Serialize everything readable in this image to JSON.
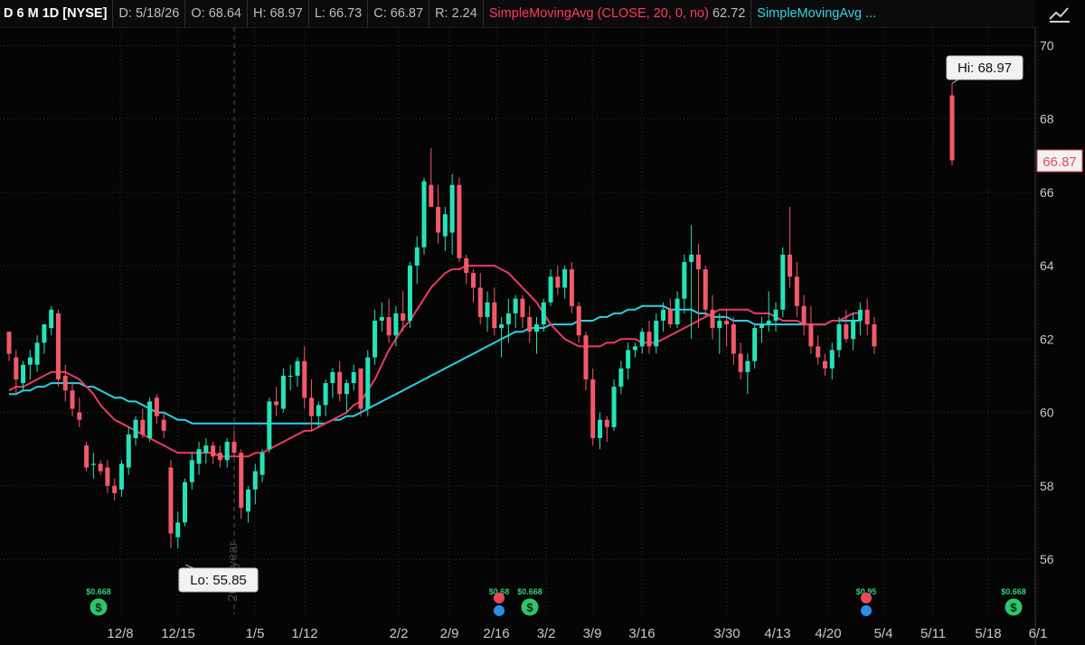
{
  "header": {
    "symbol": "D 6 M 1D [NYSE]",
    "date_label": "D:",
    "date": "5/18/26",
    "open_label": "O:",
    "open": "68.64",
    "high_label": "H:",
    "high": "68.97",
    "low_label": "L:",
    "low": "66.73",
    "close_label": "C:",
    "close": "66.87",
    "range_label": "R:",
    "range": "2.24",
    "study1": "SimpleMovingAvg (CLOSE, 20, 0, no)",
    "study1_value": "62.72",
    "study2": "SimpleMovingAvg ..."
  },
  "icons": {
    "style_button": "trend-line-icon",
    "dividend": "dollar-icon",
    "earnings": "earnings-icon"
  },
  "colors": {
    "up": "#25e3b8",
    "down": "#f2596b",
    "sma20": "#ea3a62",
    "sma50": "#27d3e6",
    "grid": "#2f2f2f",
    "background": "#050505"
  },
  "chart_data": {
    "type": "candlestick",
    "ylim": [
      54.5,
      70.5
    ],
    "y_ticks": [
      "56",
      "58",
      "60",
      "62",
      "64",
      "66",
      "68",
      "70"
    ],
    "x_ticks": [
      "12/8",
      "12/15",
      "1/5",
      "1/12",
      "2/2",
      "2/9",
      "2/16",
      "3/2",
      "3/9",
      "3/16",
      "3/30",
      "4/13",
      "4/20",
      "5/4",
      "5/11",
      "5/18",
      "6/1"
    ],
    "year_marker": "2026 year",
    "last_price": "66.87",
    "hi_label": "Hi: 68.97",
    "lo_label": "Lo: 55.85",
    "series": [
      {
        "name": "SimpleMovingAvg (CLOSE, 20, 0, no)",
        "color": "#ea3a62",
        "current": 62.72
      },
      {
        "name": "SimpleMovingAvg ...",
        "color": "#27d3e6"
      }
    ],
    "candles_price_ohlc_note": "o,h,l,c per trading day",
    "candles": [
      [
        62.2,
        62.2,
        61.4,
        61.6
      ],
      [
        61.5,
        61.7,
        60.5,
        60.9
      ],
      [
        60.8,
        61.4,
        60.6,
        61.3
      ],
      [
        61.3,
        61.7,
        60.9,
        61.5
      ],
      [
        61.3,
        62.1,
        61.1,
        61.9
      ],
      [
        61.9,
        62.4,
        61.6,
        62.4
      ],
      [
        62.3,
        62.9,
        62.1,
        62.8
      ],
      [
        62.7,
        62.8,
        60.7,
        60.9
      ],
      [
        61.0,
        61.3,
        60.3,
        60.6
      ],
      [
        60.6,
        60.8,
        59.9,
        60.1
      ],
      [
        60.0,
        60.4,
        59.6,
        59.8
      ],
      [
        59.1,
        59.2,
        58.4,
        58.5
      ],
      [
        58.6,
        58.9,
        58.2,
        58.6
      ],
      [
        58.6,
        58.7,
        58.3,
        58.4
      ],
      [
        58.5,
        58.7,
        57.8,
        58.0
      ],
      [
        58.0,
        58.2,
        57.6,
        57.8
      ],
      [
        57.9,
        58.7,
        57.7,
        58.6
      ],
      [
        58.5,
        59.6,
        58.3,
        59.4
      ],
      [
        59.3,
        59.9,
        59.1,
        59.8
      ],
      [
        59.8,
        60.1,
        59.3,
        59.4
      ],
      [
        59.3,
        60.4,
        59.2,
        60.3
      ],
      [
        60.4,
        60.5,
        59.7,
        59.9
      ],
      [
        59.8,
        60.0,
        59.3,
        59.5
      ],
      [
        58.5,
        58.7,
        56.3,
        56.7
      ],
      [
        56.6,
        57.3,
        56.3,
        57.0
      ],
      [
        57.0,
        58.2,
        56.9,
        58.1
      ],
      [
        58.1,
        58.9,
        57.9,
        58.7
      ],
      [
        58.6,
        59.2,
        58.3,
        59.0
      ],
      [
        58.9,
        59.3,
        58.6,
        59.1
      ],
      [
        59.1,
        59.2,
        58.6,
        58.8
      ],
      [
        58.9,
        59.1,
        58.5,
        58.7
      ],
      [
        58.7,
        59.3,
        58.5,
        59.2
      ],
      [
        59.2,
        59.5,
        58.8,
        58.9
      ],
      [
        58.9,
        59.0,
        57.1,
        57.4
      ],
      [
        57.3,
        58.0,
        57.0,
        57.9
      ],
      [
        57.9,
        58.6,
        57.5,
        58.4
      ],
      [
        58.3,
        59.0,
        58.1,
        58.9
      ],
      [
        59.0,
        60.4,
        58.9,
        60.3
      ],
      [
        60.3,
        60.7,
        59.9,
        60.2
      ],
      [
        60.1,
        61.2,
        60.0,
        61.0
      ],
      [
        61.0,
        61.3,
        60.6,
        61.0
      ],
      [
        61.0,
        61.5,
        60.7,
        61.4
      ],
      [
        61.4,
        61.8,
        60.1,
        60.4
      ],
      [
        60.4,
        60.9,
        59.5,
        59.9
      ],
      [
        59.9,
        60.3,
        59.6,
        60.2
      ],
      [
        60.2,
        60.9,
        59.9,
        60.8
      ],
      [
        60.8,
        61.2,
        60.4,
        61.1
      ],
      [
        61.1,
        61.4,
        60.3,
        60.5
      ],
      [
        60.5,
        60.9,
        60.0,
        60.8
      ],
      [
        60.8,
        61.3,
        60.6,
        61.1
      ],
      [
        61.2,
        61.2,
        59.9,
        60.1
      ],
      [
        60.1,
        61.7,
        59.9,
        61.5
      ],
      [
        61.5,
        62.8,
        61.3,
        62.5
      ],
      [
        62.5,
        63.0,
        62.2,
        62.6
      ],
      [
        62.6,
        63.1,
        61.9,
        62.1
      ],
      [
        62.1,
        62.9,
        61.8,
        62.7
      ],
      [
        62.7,
        63.3,
        62.2,
        62.5
      ],
      [
        62.5,
        64.1,
        62.3,
        64.0
      ],
      [
        64.0,
        64.8,
        63.5,
        64.5
      ],
      [
        64.5,
        66.4,
        64.3,
        66.3
      ],
      [
        66.2,
        67.2,
        65.8,
        65.6
      ],
      [
        65.6,
        66.2,
        64.6,
        64.9
      ],
      [
        64.8,
        65.6,
        64.4,
        65.4
      ],
      [
        64.9,
        66.5,
        64.3,
        66.2
      ],
      [
        66.2,
        66.4,
        64.1,
        64.2
      ],
      [
        64.2,
        64.3,
        63.5,
        63.8
      ],
      [
        63.8,
        63.9,
        63.0,
        63.4
      ],
      [
        63.4,
        63.8,
        62.4,
        62.6
      ],
      [
        62.6,
        63.3,
        62.2,
        63.0
      ],
      [
        63.0,
        63.4,
        62.1,
        62.3
      ],
      [
        62.3,
        62.6,
        61.5,
        62.4
      ],
      [
        62.4,
        63.1,
        61.9,
        62.7
      ],
      [
        62.7,
        63.2,
        62.3,
        63.1
      ],
      [
        63.1,
        63.2,
        62.3,
        62.6
      ],
      [
        62.6,
        62.9,
        61.9,
        62.2
      ],
      [
        62.2,
        62.6,
        61.6,
        62.4
      ],
      [
        62.4,
        63.1,
        62.2,
        63.0
      ],
      [
        63.0,
        63.9,
        62.9,
        63.7
      ],
      [
        63.7,
        64.0,
        63.2,
        63.4
      ],
      [
        63.4,
        64.0,
        63.1,
        63.9
      ],
      [
        63.9,
        64.1,
        62.7,
        62.9
      ],
      [
        62.9,
        63.0,
        61.9,
        62.1
      ],
      [
        62.1,
        62.2,
        60.6,
        60.9
      ],
      [
        60.9,
        61.2,
        59.1,
        59.3
      ],
      [
        59.3,
        60.0,
        59.0,
        59.8
      ],
      [
        59.8,
        59.9,
        59.2,
        59.6
      ],
      [
        59.6,
        60.9,
        59.5,
        60.7
      ],
      [
        60.7,
        61.4,
        60.5,
        61.2
      ],
      [
        61.2,
        61.9,
        60.9,
        61.7
      ],
      [
        61.7,
        61.9,
        61.5,
        61.8
      ],
      [
        61.8,
        62.3,
        61.6,
        62.2
      ],
      [
        62.2,
        62.5,
        61.6,
        61.8
      ],
      [
        61.8,
        62.7,
        61.6,
        62.5
      ],
      [
        62.5,
        63.0,
        62.2,
        62.8
      ],
      [
        62.8,
        63.1,
        62.3,
        62.4
      ],
      [
        62.4,
        63.3,
        62.3,
        63.1
      ],
      [
        63.1,
        64.3,
        62.7,
        64.1
      ],
      [
        64.1,
        65.1,
        62.0,
        64.3
      ],
      [
        64.3,
        64.6,
        62.3,
        63.9
      ],
      [
        63.9,
        64.0,
        62.6,
        62.8
      ],
      [
        62.8,
        63.2,
        62.0,
        62.3
      ],
      [
        62.3,
        62.7,
        61.6,
        62.5
      ],
      [
        62.5,
        62.8,
        61.8,
        62.4
      ],
      [
        62.4,
        62.6,
        61.3,
        61.6
      ],
      [
        61.6,
        61.9,
        60.9,
        61.1
      ],
      [
        61.1,
        61.6,
        60.5,
        61.4
      ],
      [
        61.4,
        62.4,
        61.2,
        62.3
      ],
      [
        62.3,
        62.6,
        61.9,
        62.4
      ],
      [
        62.4,
        63.3,
        62.2,
        62.5
      ],
      [
        62.5,
        63.0,
        62.2,
        62.8
      ],
      [
        62.8,
        64.5,
        62.6,
        64.3
      ],
      [
        64.3,
        65.6,
        63.4,
        63.7
      ],
      [
        63.7,
        64.1,
        62.6,
        62.9
      ],
      [
        62.9,
        63.2,
        62.1,
        62.4
      ],
      [
        62.4,
        62.9,
        61.6,
        61.8
      ],
      [
        61.8,
        62.1,
        61.3,
        61.5
      ],
      [
        61.4,
        61.6,
        61.0,
        61.2
      ],
      [
        61.2,
        61.9,
        60.9,
        61.7
      ],
      [
        61.7,
        62.6,
        61.5,
        62.4
      ],
      [
        62.4,
        62.8,
        61.9,
        62.0
      ],
      [
        62.0,
        62.7,
        61.7,
        62.5
      ],
      [
        62.5,
        63.0,
        62.1,
        62.8
      ],
      [
        62.8,
        63.1,
        62.1,
        62.4
      ],
      [
        62.4,
        62.6,
        61.6,
        61.8
      ],
      [
        68.64,
        68.97,
        66.73,
        66.87
      ]
    ],
    "sma20": [
      60.6,
      60.7,
      60.7,
      60.8,
      60.9,
      61.0,
      61.1,
      61.1,
      61.1,
      61.0,
      60.9,
      60.7,
      60.5,
      60.2,
      60.0,
      59.8,
      59.7,
      59.6,
      59.5,
      59.4,
      59.3,
      59.2,
      59.1,
      59.0,
      58.9,
      58.9,
      58.9,
      58.9,
      58.9,
      58.9,
      58.8,
      58.8,
      58.8,
      58.8,
      58.8,
      58.9,
      58.9,
      59.0,
      59.1,
      59.2,
      59.3,
      59.4,
      59.5,
      59.5,
      59.6,
      59.7,
      59.8,
      59.9,
      60.0,
      60.2,
      60.3,
      60.6,
      60.9,
      61.3,
      61.7,
      62.0,
      62.3,
      62.5,
      62.8,
      63.1,
      63.4,
      63.6,
      63.8,
      63.9,
      63.9,
      64.0,
      64.0,
      64.0,
      64.0,
      64.0,
      63.9,
      63.8,
      63.6,
      63.4,
      63.2,
      63.0,
      62.7,
      62.4,
      62.2,
      62.0,
      61.9,
      61.8,
      61.8,
      61.8,
      61.8,
      61.9,
      61.9,
      62.0,
      62.0,
      62.0,
      61.9,
      61.9,
      61.9,
      62.0,
      62.1,
      62.2,
      62.3,
      62.4,
      62.5,
      62.6,
      62.7,
      62.8,
      62.8,
      62.8,
      62.8,
      62.8,
      62.7,
      62.7,
      62.7,
      62.6,
      62.5,
      62.5,
      62.5,
      62.4,
      62.4,
      62.4,
      62.4,
      62.5,
      62.5,
      62.6,
      62.7,
      62.72
    ],
    "sma50": [
      60.5,
      60.5,
      60.6,
      60.6,
      60.7,
      60.7,
      60.8,
      60.8,
      60.8,
      60.8,
      60.8,
      60.7,
      60.7,
      60.6,
      60.5,
      60.4,
      60.4,
      60.3,
      60.3,
      60.2,
      60.1,
      60.0,
      60.0,
      59.9,
      59.8,
      59.8,
      59.7,
      59.7,
      59.7,
      59.7,
      59.7,
      59.7,
      59.7,
      59.7,
      59.7,
      59.7,
      59.7,
      59.7,
      59.7,
      59.7,
      59.7,
      59.7,
      59.7,
      59.7,
      59.7,
      59.7,
      59.8,
      59.8,
      59.9,
      59.9,
      60.0,
      60.1,
      60.2,
      60.3,
      60.4,
      60.5,
      60.6,
      60.7,
      60.8,
      60.9,
      61.0,
      61.1,
      61.2,
      61.3,
      61.4,
      61.5,
      61.6,
      61.7,
      61.8,
      61.9,
      62.0,
      62.1,
      62.2,
      62.2,
      62.3,
      62.3,
      62.3,
      62.4,
      62.4,
      62.4,
      62.4,
      62.5,
      62.5,
      62.5,
      62.6,
      62.6,
      62.7,
      62.7,
      62.8,
      62.8,
      62.9,
      62.9,
      62.9,
      62.9,
      62.8,
      62.8,
      62.8,
      62.8,
      62.7,
      62.7,
      62.6,
      62.6,
      62.6,
      62.5,
      62.5,
      62.5,
      62.4,
      62.4,
      62.4,
      62.4,
      62.4,
      62.4,
      62.4,
      62.4,
      62.4,
      62.4,
      62.4,
      62.5,
      62.5,
      62.5,
      62.5,
      62.5
    ],
    "dividend_markers": [
      {
        "label": "$0.668",
        "x_index": 13,
        "type": "dividend"
      },
      {
        "label": "$0.68",
        "x_index": 67,
        "type": "earnings"
      },
      {
        "label": "$0.668",
        "x_index": 71,
        "type": "dividend"
      },
      {
        "label": "$0.95",
        "x_index": 117,
        "type": "earnings"
      },
      {
        "label": "$0.668",
        "x_index": 136,
        "type": "dividend"
      }
    ]
  }
}
